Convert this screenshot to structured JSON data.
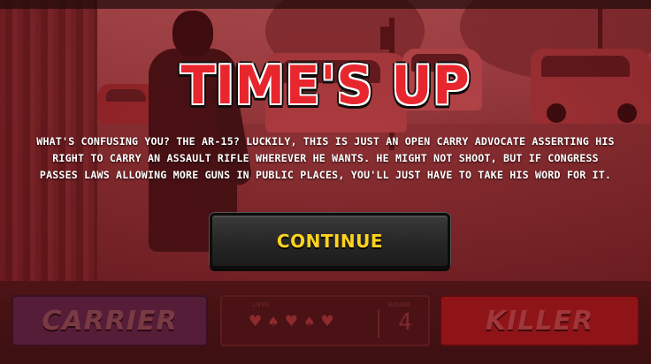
{
  "modal": {
    "title": "TIME'S UP",
    "message": "WHAT'S CONFUSING YOU? THE AR-15? LUCKILY, THIS IS JUST AN OPEN CARRY ADVOCATE ASSERTING HIS RIGHT TO CARRY AN ASSAULT RIFLE WHEREVER HE WANTS. HE MIGHT NOT SHOOT, BUT IF CONGRESS PASSES LAWS ALLOWING MORE GUNS IN PUBLIC PLACES, YOU'LL JUST HAVE TO TAKE HIS WORD FOR IT.",
    "continue_label": "CONTINUE"
  },
  "hud": {
    "carrier_label": "CARRIER",
    "killer_label": "KILLER",
    "lives_caption": "LIVES",
    "round_caption": "ROUND",
    "round_value": "4",
    "lives": [
      "heart",
      "spade",
      "heart",
      "spade",
      "heart"
    ]
  },
  "colors": {
    "title_red": "#e8262e",
    "button_text": "#ffd21f",
    "carrier_bg": "#551d38",
    "killer_bg": "#8e1418"
  }
}
